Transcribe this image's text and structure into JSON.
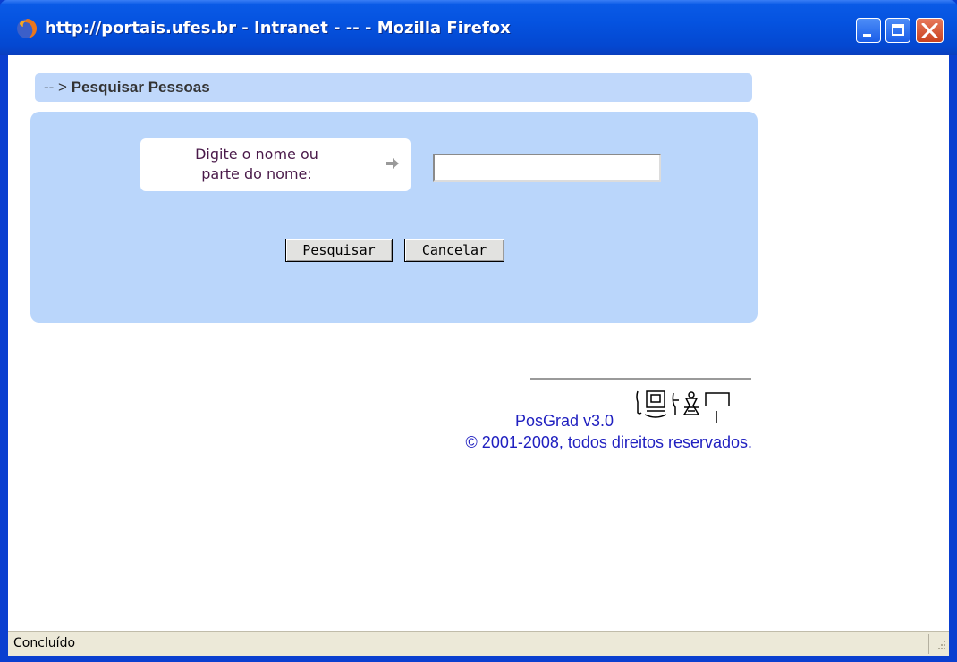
{
  "window": {
    "title": "http://portais.ufes.br - Intranet - -- - Mozilla Firefox",
    "controls": {
      "minimize": "minimize",
      "maximize": "maximize",
      "close": "close"
    }
  },
  "page": {
    "breadcrumb_prefix": "-- >",
    "breadcrumb_title": "Pesquisar Pessoas",
    "search": {
      "label_line1": "Digite o nome ou",
      "label_line2": "parte do nome:",
      "input_value": "",
      "input_placeholder": ""
    },
    "buttons": {
      "search_label": "Pesquisar",
      "cancel_label": "Cancelar"
    },
    "footer": {
      "version": "PosGrad v3.0",
      "copyright": "© 2001-2008, todos direitos reservados."
    }
  },
  "statusbar": {
    "text": "Concluído"
  },
  "colors": {
    "titlebar": "#0553e0",
    "header_bar": "#c0d8fb",
    "panel": "#bad6fb",
    "footer_link": "#2020c0",
    "close_button": "#c9421f"
  },
  "icons": {
    "title": "firefox-icon",
    "label_arrow": "arrow-right-icon",
    "logo": "hieroglyph-logo",
    "resize": "resize-grip-icon"
  }
}
